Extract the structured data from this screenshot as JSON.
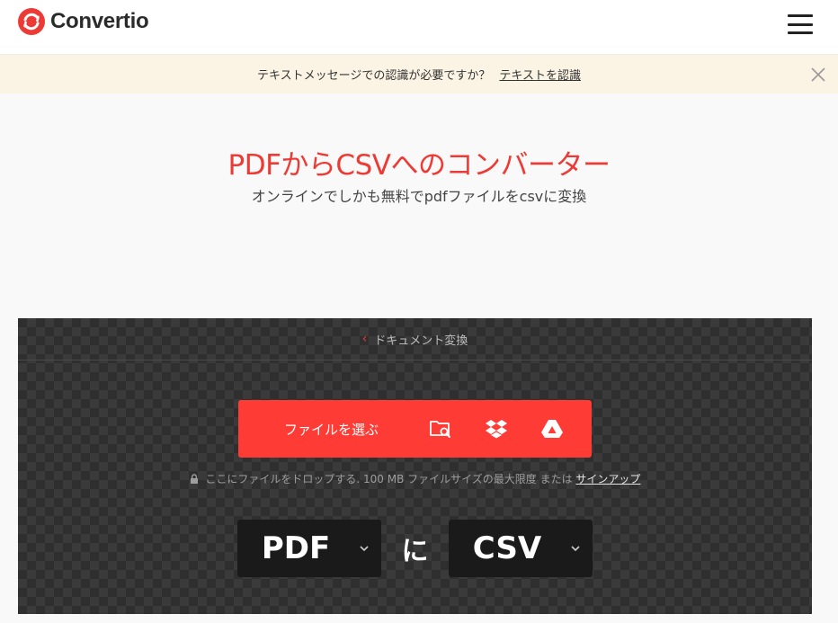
{
  "header": {
    "brand": "Convertio",
    "menu_icon": "hamburger-menu-icon"
  },
  "notice": {
    "text": "テキストメッセージでの認識が必要ですか？",
    "link": "テキストを認識",
    "close_icon": "close-icon"
  },
  "hero": {
    "title": "PDFからCSVへのコンバーター",
    "subtitle": "オンラインでしかも無料でpdfファイルをcsvに変換"
  },
  "converter": {
    "breadcrumb": "ドキュメント変換",
    "choose_label": "ファイルを選ぶ",
    "sources": [
      "folder-search-icon",
      "dropbox-icon",
      "google-drive-icon"
    ],
    "drop_hint": "ここにファイルをドロップする. 100 MB ファイルサイズの最大限度 または",
    "signup_link": "サインアップ",
    "from_format": "PDF",
    "to_word": "に",
    "to_format": "CSV"
  },
  "colors": {
    "accent": "#ff3b35",
    "brand_red": "#ee3a35",
    "notice_bg": "#fbf4e4",
    "panel_bg": "#2f2f2f"
  }
}
